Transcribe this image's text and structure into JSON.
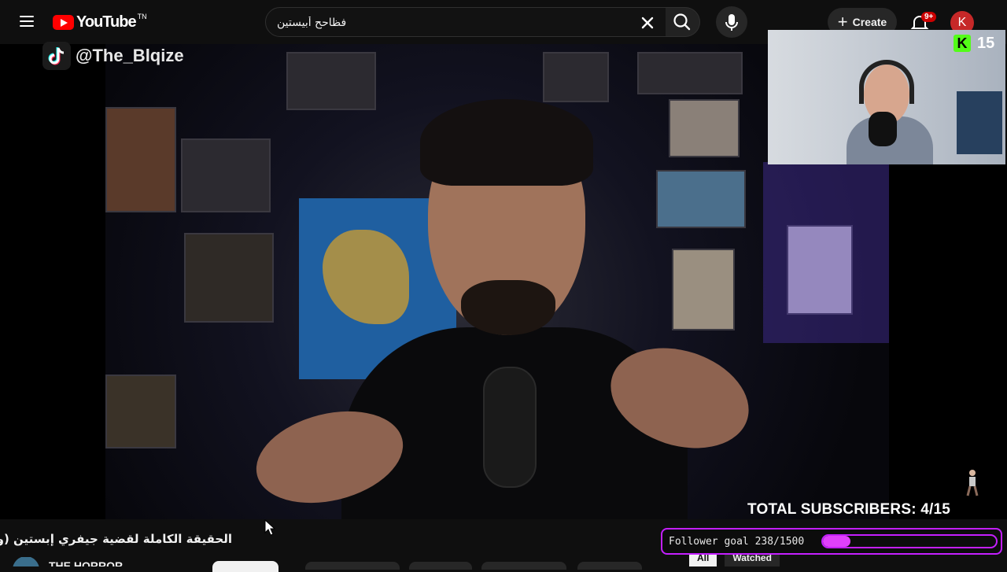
{
  "header": {
    "logo_text": "YouTube",
    "logo_tm": "TN",
    "search": {
      "value": "فظاحح أبيستين",
      "placeholder": "Search"
    },
    "create_label": "Create",
    "notification_count": "9+",
    "avatar_letter": "K"
  },
  "overlay": {
    "tiktok_handle": "@The_Blqize",
    "kick_count": "15",
    "kick_letter": "K",
    "total_subscribers": "TOTAL SUBSCRIBERS: 4/15",
    "follower_goal_text": "Follower goal 238/1500",
    "follower_goal_fraction": 0.1587
  },
  "video": {
    "title": "الحقيقة الكاملة لقضية جيفري إبستين (وثائقي)",
    "channel_name": "THE HORROR"
  },
  "filter_chips": [
    {
      "label": "All",
      "active": true
    },
    {
      "label": "Watched",
      "active": false
    }
  ],
  "colors": {
    "accent": "#c41fff",
    "goal_fill": "#e040fb",
    "kick_green": "#53fc18",
    "brand_red": "#ff0000"
  }
}
